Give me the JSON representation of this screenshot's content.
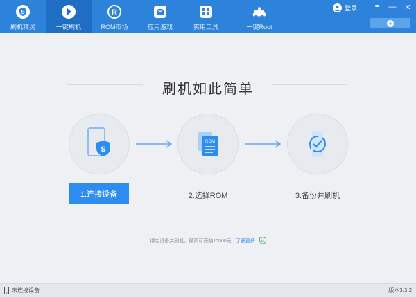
{
  "nav": {
    "items": [
      {
        "label": "刷机精灵",
        "icon": "shield-s-icon"
      },
      {
        "label": "一键刷机",
        "icon": "play-icon"
      },
      {
        "label": "ROM市场",
        "icon": "rom-r-icon"
      },
      {
        "label": "应用游戏",
        "icon": "mail-icon"
      },
      {
        "label": "实用工具",
        "icon": "grid-icon"
      },
      {
        "label": "一键Root",
        "icon": "root-car-icon"
      }
    ],
    "active_index": 1
  },
  "header": {
    "login_label": "登录",
    "menu_icon": "≡",
    "minimize_icon": "—",
    "close_icon": "✕"
  },
  "main": {
    "title": "刷机如此简单",
    "steps": [
      {
        "label": "1.连接设备",
        "icon": "phone-shield-icon"
      },
      {
        "label": "2.选择ROM",
        "icon": "rom-files-icon"
      },
      {
        "label": "3.备份并刷机",
        "icon": "backup-clock-icon"
      }
    ],
    "promo_text": "绑定设备并刷机，最高可获赔10000元",
    "promo_link": "了解更多"
  },
  "status": {
    "connection": "未连接设备",
    "version": "版本3.3.2"
  },
  "colors": {
    "topbar": "#2d82d9",
    "active_tab": "#1f6ec4",
    "accent": "#2d8cf0",
    "background": "#eef0f3"
  }
}
